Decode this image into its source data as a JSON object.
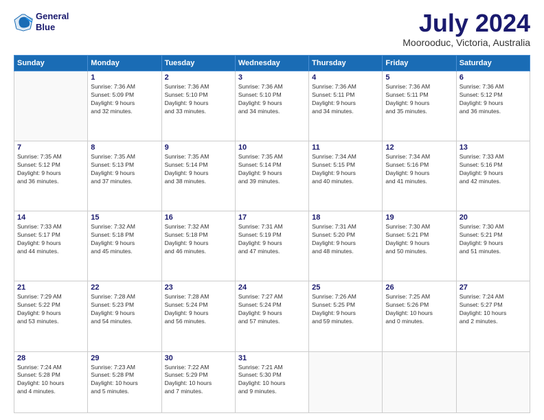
{
  "header": {
    "logo_line1": "General",
    "logo_line2": "Blue",
    "month": "July 2024",
    "location": "Moorooduc, Victoria, Australia"
  },
  "days_of_week": [
    "Sunday",
    "Monday",
    "Tuesday",
    "Wednesday",
    "Thursday",
    "Friday",
    "Saturday"
  ],
  "weeks": [
    [
      {
        "day": "",
        "info": ""
      },
      {
        "day": "1",
        "info": "Sunrise: 7:36 AM\nSunset: 5:09 PM\nDaylight: 9 hours\nand 32 minutes."
      },
      {
        "day": "2",
        "info": "Sunrise: 7:36 AM\nSunset: 5:10 PM\nDaylight: 9 hours\nand 33 minutes."
      },
      {
        "day": "3",
        "info": "Sunrise: 7:36 AM\nSunset: 5:10 PM\nDaylight: 9 hours\nand 34 minutes."
      },
      {
        "day": "4",
        "info": "Sunrise: 7:36 AM\nSunset: 5:11 PM\nDaylight: 9 hours\nand 34 minutes."
      },
      {
        "day": "5",
        "info": "Sunrise: 7:36 AM\nSunset: 5:11 PM\nDaylight: 9 hours\nand 35 minutes."
      },
      {
        "day": "6",
        "info": "Sunrise: 7:36 AM\nSunset: 5:12 PM\nDaylight: 9 hours\nand 36 minutes."
      }
    ],
    [
      {
        "day": "7",
        "info": "Sunrise: 7:35 AM\nSunset: 5:12 PM\nDaylight: 9 hours\nand 36 minutes."
      },
      {
        "day": "8",
        "info": "Sunrise: 7:35 AM\nSunset: 5:13 PM\nDaylight: 9 hours\nand 37 minutes."
      },
      {
        "day": "9",
        "info": "Sunrise: 7:35 AM\nSunset: 5:14 PM\nDaylight: 9 hours\nand 38 minutes."
      },
      {
        "day": "10",
        "info": "Sunrise: 7:35 AM\nSunset: 5:14 PM\nDaylight: 9 hours\nand 39 minutes."
      },
      {
        "day": "11",
        "info": "Sunrise: 7:34 AM\nSunset: 5:15 PM\nDaylight: 9 hours\nand 40 minutes."
      },
      {
        "day": "12",
        "info": "Sunrise: 7:34 AM\nSunset: 5:16 PM\nDaylight: 9 hours\nand 41 minutes."
      },
      {
        "day": "13",
        "info": "Sunrise: 7:33 AM\nSunset: 5:16 PM\nDaylight: 9 hours\nand 42 minutes."
      }
    ],
    [
      {
        "day": "14",
        "info": "Sunrise: 7:33 AM\nSunset: 5:17 PM\nDaylight: 9 hours\nand 44 minutes."
      },
      {
        "day": "15",
        "info": "Sunrise: 7:32 AM\nSunset: 5:18 PM\nDaylight: 9 hours\nand 45 minutes."
      },
      {
        "day": "16",
        "info": "Sunrise: 7:32 AM\nSunset: 5:18 PM\nDaylight: 9 hours\nand 46 minutes."
      },
      {
        "day": "17",
        "info": "Sunrise: 7:31 AM\nSunset: 5:19 PM\nDaylight: 9 hours\nand 47 minutes."
      },
      {
        "day": "18",
        "info": "Sunrise: 7:31 AM\nSunset: 5:20 PM\nDaylight: 9 hours\nand 48 minutes."
      },
      {
        "day": "19",
        "info": "Sunrise: 7:30 AM\nSunset: 5:21 PM\nDaylight: 9 hours\nand 50 minutes."
      },
      {
        "day": "20",
        "info": "Sunrise: 7:30 AM\nSunset: 5:21 PM\nDaylight: 9 hours\nand 51 minutes."
      }
    ],
    [
      {
        "day": "21",
        "info": "Sunrise: 7:29 AM\nSunset: 5:22 PM\nDaylight: 9 hours\nand 53 minutes."
      },
      {
        "day": "22",
        "info": "Sunrise: 7:28 AM\nSunset: 5:23 PM\nDaylight: 9 hours\nand 54 minutes."
      },
      {
        "day": "23",
        "info": "Sunrise: 7:28 AM\nSunset: 5:24 PM\nDaylight: 9 hours\nand 56 minutes."
      },
      {
        "day": "24",
        "info": "Sunrise: 7:27 AM\nSunset: 5:24 PM\nDaylight: 9 hours\nand 57 minutes."
      },
      {
        "day": "25",
        "info": "Sunrise: 7:26 AM\nSunset: 5:25 PM\nDaylight: 9 hours\nand 59 minutes."
      },
      {
        "day": "26",
        "info": "Sunrise: 7:25 AM\nSunset: 5:26 PM\nDaylight: 10 hours\nand 0 minutes."
      },
      {
        "day": "27",
        "info": "Sunrise: 7:24 AM\nSunset: 5:27 PM\nDaylight: 10 hours\nand 2 minutes."
      }
    ],
    [
      {
        "day": "28",
        "info": "Sunrise: 7:24 AM\nSunset: 5:28 PM\nDaylight: 10 hours\nand 4 minutes."
      },
      {
        "day": "29",
        "info": "Sunrise: 7:23 AM\nSunset: 5:28 PM\nDaylight: 10 hours\nand 5 minutes."
      },
      {
        "day": "30",
        "info": "Sunrise: 7:22 AM\nSunset: 5:29 PM\nDaylight: 10 hours\nand 7 minutes."
      },
      {
        "day": "31",
        "info": "Sunrise: 7:21 AM\nSunset: 5:30 PM\nDaylight: 10 hours\nand 9 minutes."
      },
      {
        "day": "",
        "info": ""
      },
      {
        "day": "",
        "info": ""
      },
      {
        "day": "",
        "info": ""
      }
    ]
  ]
}
